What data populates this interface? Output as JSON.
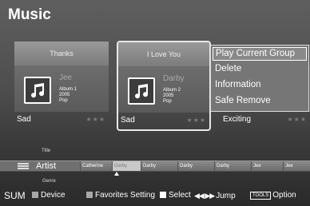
{
  "title": "Music",
  "albums": [
    {
      "name": "Thanks",
      "artist": "Jee",
      "album": "Album 1",
      "year": "2005",
      "genre": "Pop",
      "mood": "Sad",
      "stars": "★★★"
    },
    {
      "name": "I Love You",
      "artist": "Darby",
      "album": "Album 2",
      "year": "2005",
      "genre": "Pop",
      "mood": "Sad",
      "stars": "★★★"
    },
    {
      "mood": "Exciting",
      "stars": "★★★"
    }
  ],
  "context_menu": [
    "Play Current Group",
    "Delete",
    "Information",
    "Safe Remove"
  ],
  "sort": {
    "above": "Title",
    "current": "Artist",
    "below": "Genre"
  },
  "timeline": [
    "Catherine",
    "Darby",
    "Darby",
    "Darby",
    "Darby",
    "Jee",
    "Jee"
  ],
  "bottom_bar": {
    "sum": "SUM",
    "device": "Device",
    "favorites": "Favorites Setting",
    "select": "Select",
    "jump_icon": "◀◀ ▶▶",
    "jump": "Jump",
    "tools": "TOOLS",
    "option": "Option"
  },
  "colors": {
    "background": "#4d4d4d",
    "menu": "#787878",
    "highlight": "#ffffff"
  },
  "icons": [
    "music-note-icon",
    "list-icon",
    "jump-icon"
  ]
}
